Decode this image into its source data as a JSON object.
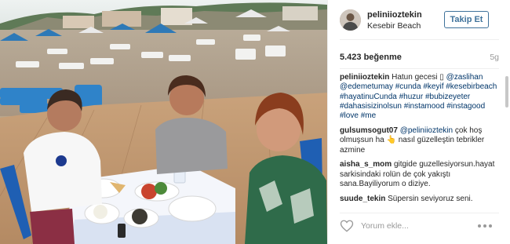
{
  "post": {
    "username": "peliniioztekin",
    "location": "Kesebir Beach",
    "follow_label": "Takip Et",
    "likes": "5.423 beğenme",
    "age": "5g",
    "caption": {
      "user": "peliniioztekin",
      "text": "Hatun gecesi ▯ @zaslihan @edemetumay #cunda #keyif #kesebirbeach #hayatinuCunda #huzur #bubizeyeter #dahasisizinolsun #instamood #instagood #love #me"
    },
    "comments": [
      {
        "user": "gulsumsogut07",
        "text": "@peliniioztekin çok hoş olmuşsun ha 👆 nasıl güzelleştin tebrikler azmine"
      },
      {
        "user": "aisha_s_mom",
        "text": "gitgide guzellesiyorsun.hayat sarkisindaki rolün de çok yakıştı sana.Bayiliyorum o diziye."
      },
      {
        "user": "suude_tekin",
        "text": "Süpersin seviyoruz seni."
      }
    ],
    "comment_placeholder": "Yorum ekle...",
    "icons": {
      "like": "heart-icon",
      "more": "more-options-icon"
    }
  },
  "colors": {
    "link": "#003569",
    "follow": "#3f729b",
    "meta": "#999999"
  }
}
